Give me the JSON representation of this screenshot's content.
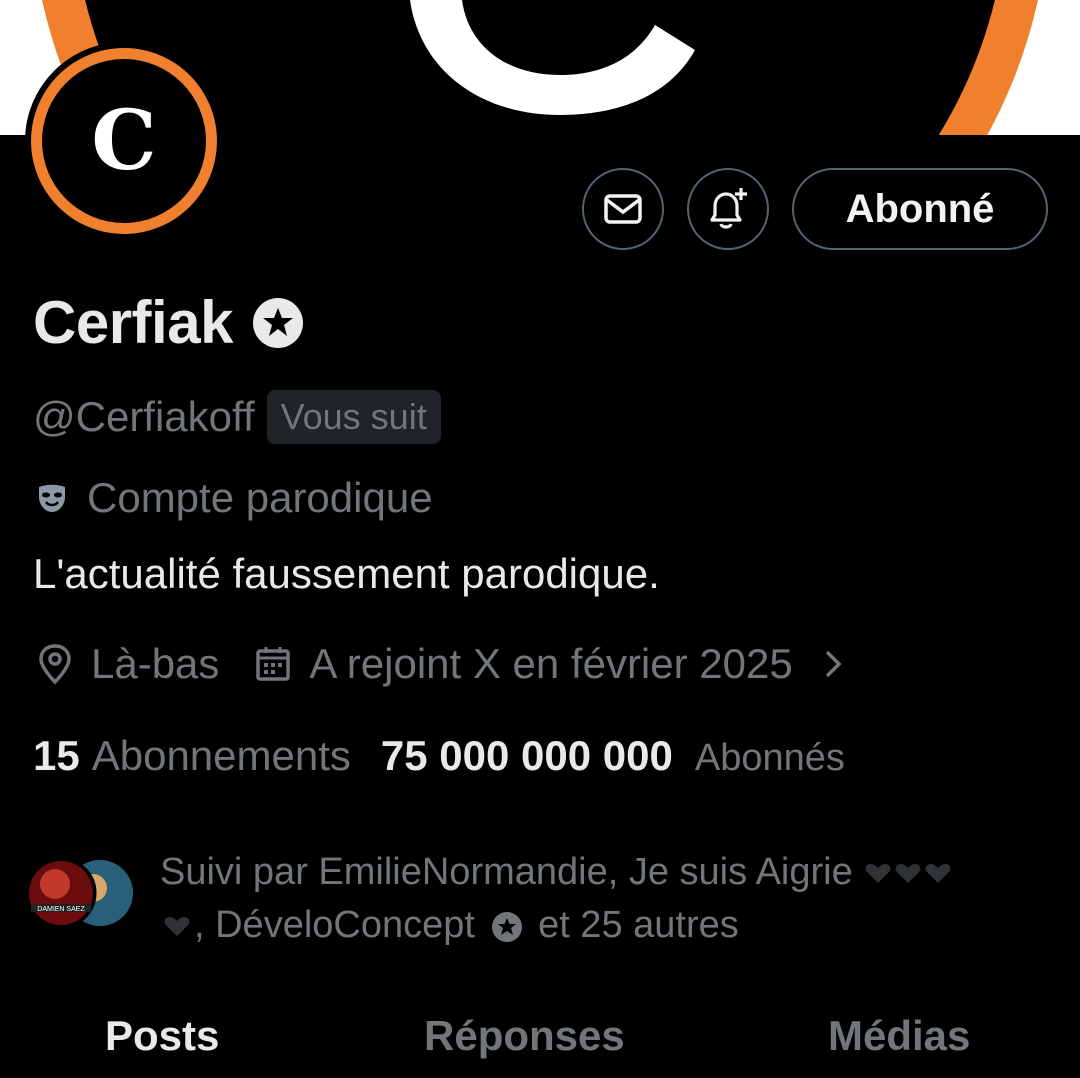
{
  "profile": {
    "display_name": "Cerfiak",
    "handle": "@Cerfiakoff",
    "follows_you": "Vous suit",
    "parody_label": "Compte parodique",
    "bio": "L'actualité faussement parodique.",
    "location": "Là-bas",
    "joined": "A rejoint X en février 2025",
    "avatar_letter": "C"
  },
  "actions": {
    "message_icon": "envelope-icon",
    "notify_icon": "bell-plus-icon",
    "follow_label": "Abonné"
  },
  "stats": {
    "following_count": "15",
    "following_label": "Abonnements",
    "followers_count": "75 000 000 000",
    "followers_label": "Abonnés"
  },
  "followed_by": {
    "prefix": "Suivi par EmilieNormandie, Je suis Aigrie",
    "middle": ", DéveloConcept",
    "suffix": "et 25 autres"
  },
  "tabs": [
    {
      "label": "Posts",
      "active": true
    },
    {
      "label": "Réponses",
      "active": false
    },
    {
      "label": "Médias",
      "active": false
    }
  ],
  "colors": {
    "background": "#000000",
    "primary_text": "#e7e9ea",
    "secondary_text": "#71767b",
    "border": "#536471",
    "brand_orange": "#f07f2e"
  }
}
